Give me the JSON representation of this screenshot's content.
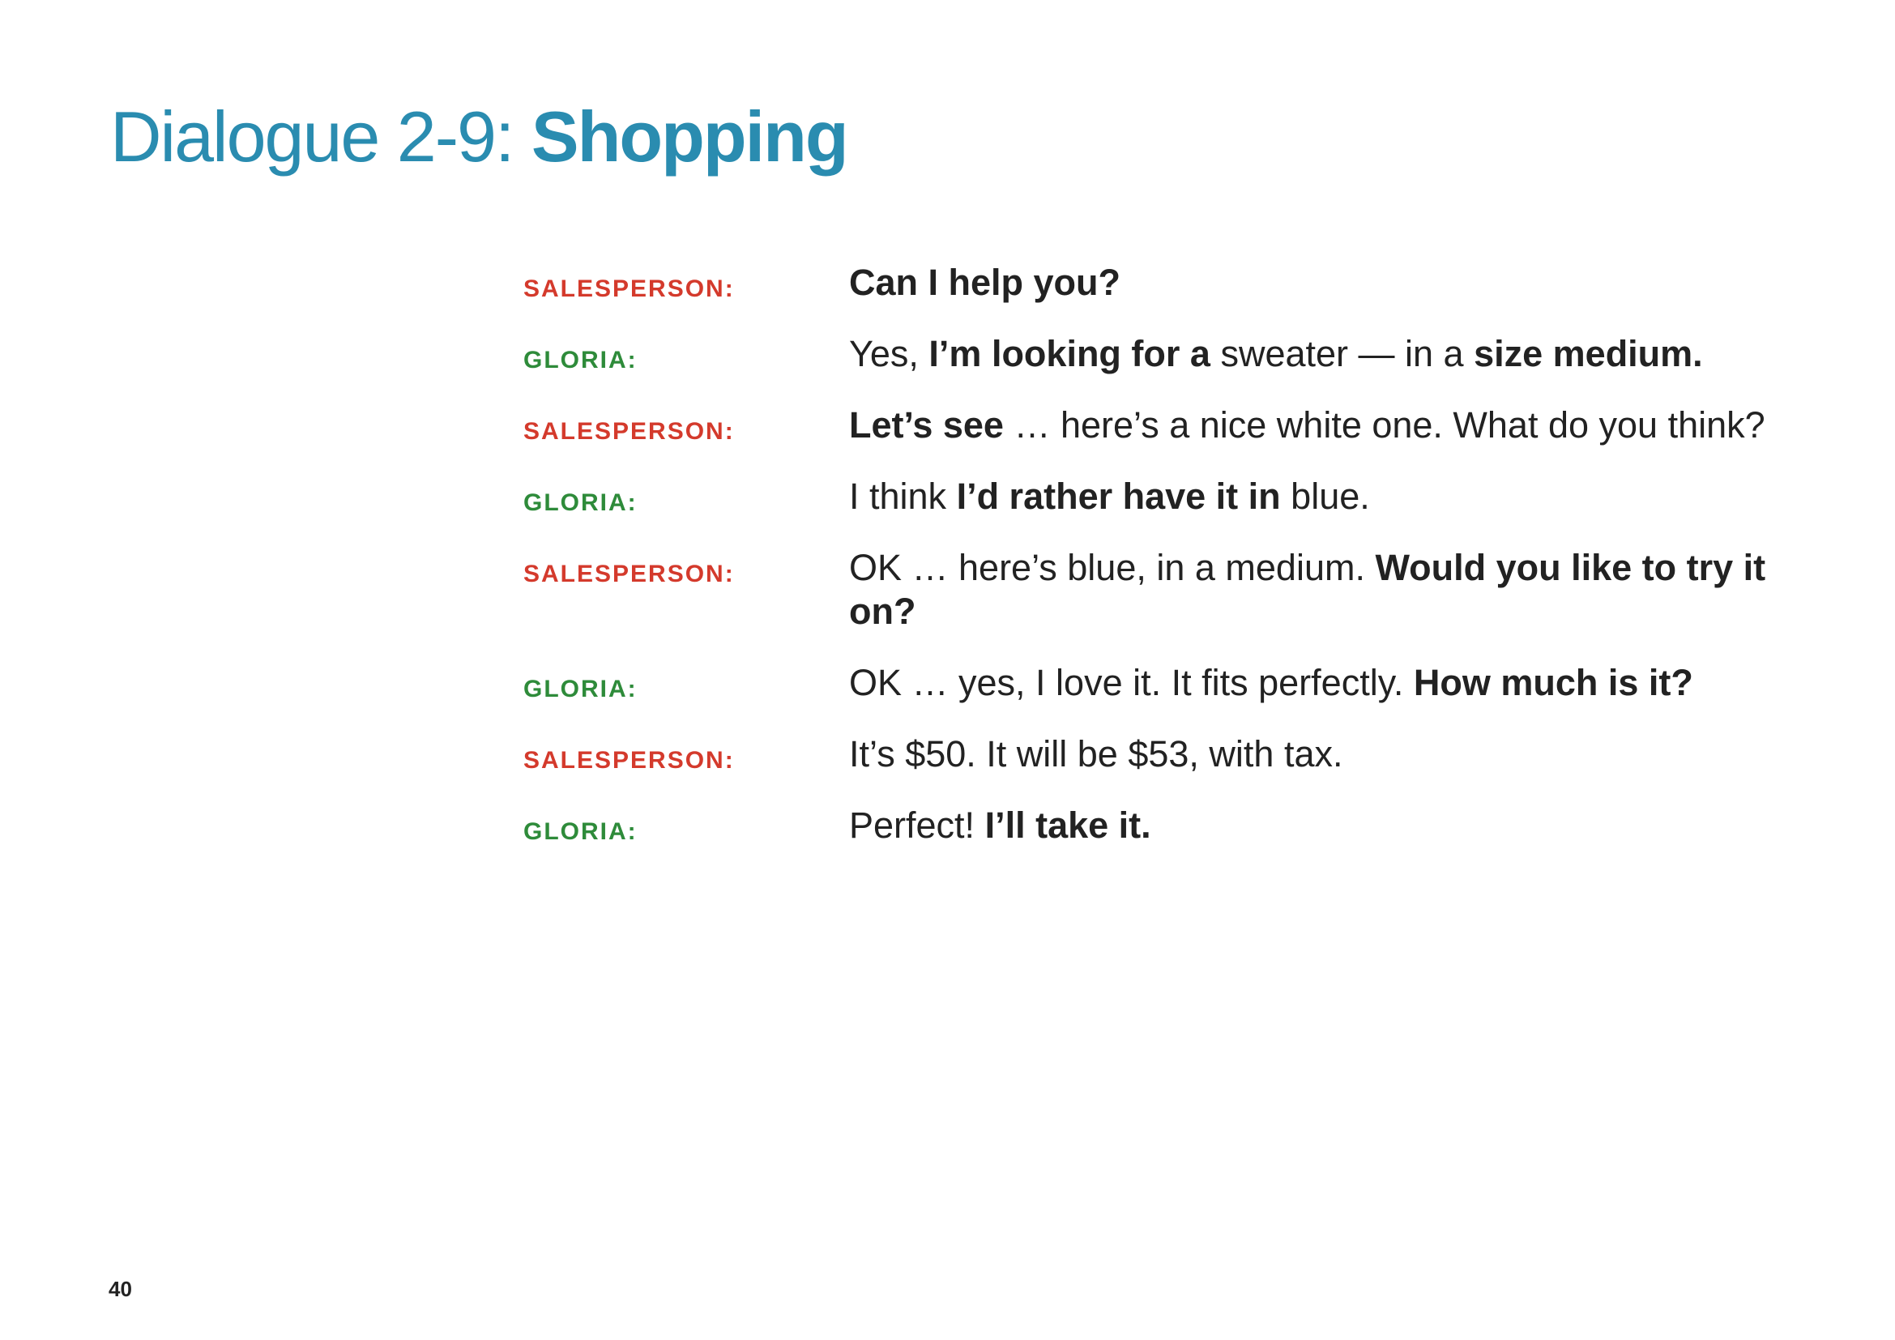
{
  "title": {
    "prefix": "Dialogue 2-9: ",
    "main": "Shopping"
  },
  "colors": {
    "title": "#2a8cb0",
    "salesperson": "#d43a2c",
    "gloria": "#2e8b3a",
    "body_text": "#222222"
  },
  "dialogue": [
    {
      "speaker": "SALESPERSON:",
      "role": "salesperson",
      "segments": [
        {
          "text": "Can I help you?",
          "bold": true
        }
      ]
    },
    {
      "speaker": "GLORIA:",
      "role": "gloria",
      "segments": [
        {
          "text": "Yes, ",
          "bold": false
        },
        {
          "text": "I’m looking for a",
          "bold": true
        },
        {
          "text": " sweater — in a ",
          "bold": false
        },
        {
          "text": "size medium.",
          "bold": true
        }
      ]
    },
    {
      "speaker": "SALESPERSON:",
      "role": "salesperson",
      "segments": [
        {
          "text": "Let’s see",
          "bold": true
        },
        {
          "text": " … here’s a nice white one. What do you think?",
          "bold": false
        }
      ]
    },
    {
      "speaker": "GLORIA:",
      "role": "gloria",
      "segments": [
        {
          "text": "I think ",
          "bold": false
        },
        {
          "text": "I’d rather have it in",
          "bold": true
        },
        {
          "text": " blue.",
          "bold": false
        }
      ]
    },
    {
      "speaker": "SALESPERSON:",
      "role": "salesperson",
      "segments": [
        {
          "text": "OK … here’s blue, in a medium. ",
          "bold": false
        },
        {
          "text": "Would you like to try it on?",
          "bold": true
        }
      ]
    },
    {
      "speaker": "GLORIA:",
      "role": "gloria",
      "segments": [
        {
          "text": "OK … yes, I love it. It fits perfectly. ",
          "bold": false
        },
        {
          "text": "How much is it?",
          "bold": true
        }
      ]
    },
    {
      "speaker": "SALESPERSON:",
      "role": "salesperson",
      "segments": [
        {
          "text": "It’s $50. It will be $53, with tax.",
          "bold": false
        }
      ]
    },
    {
      "speaker": "GLORIA:",
      "role": "gloria",
      "segments": [
        {
          "text": "Perfect! ",
          "bold": false
        },
        {
          "text": "I’ll take it.",
          "bold": true
        }
      ]
    }
  ],
  "page_number": "40"
}
